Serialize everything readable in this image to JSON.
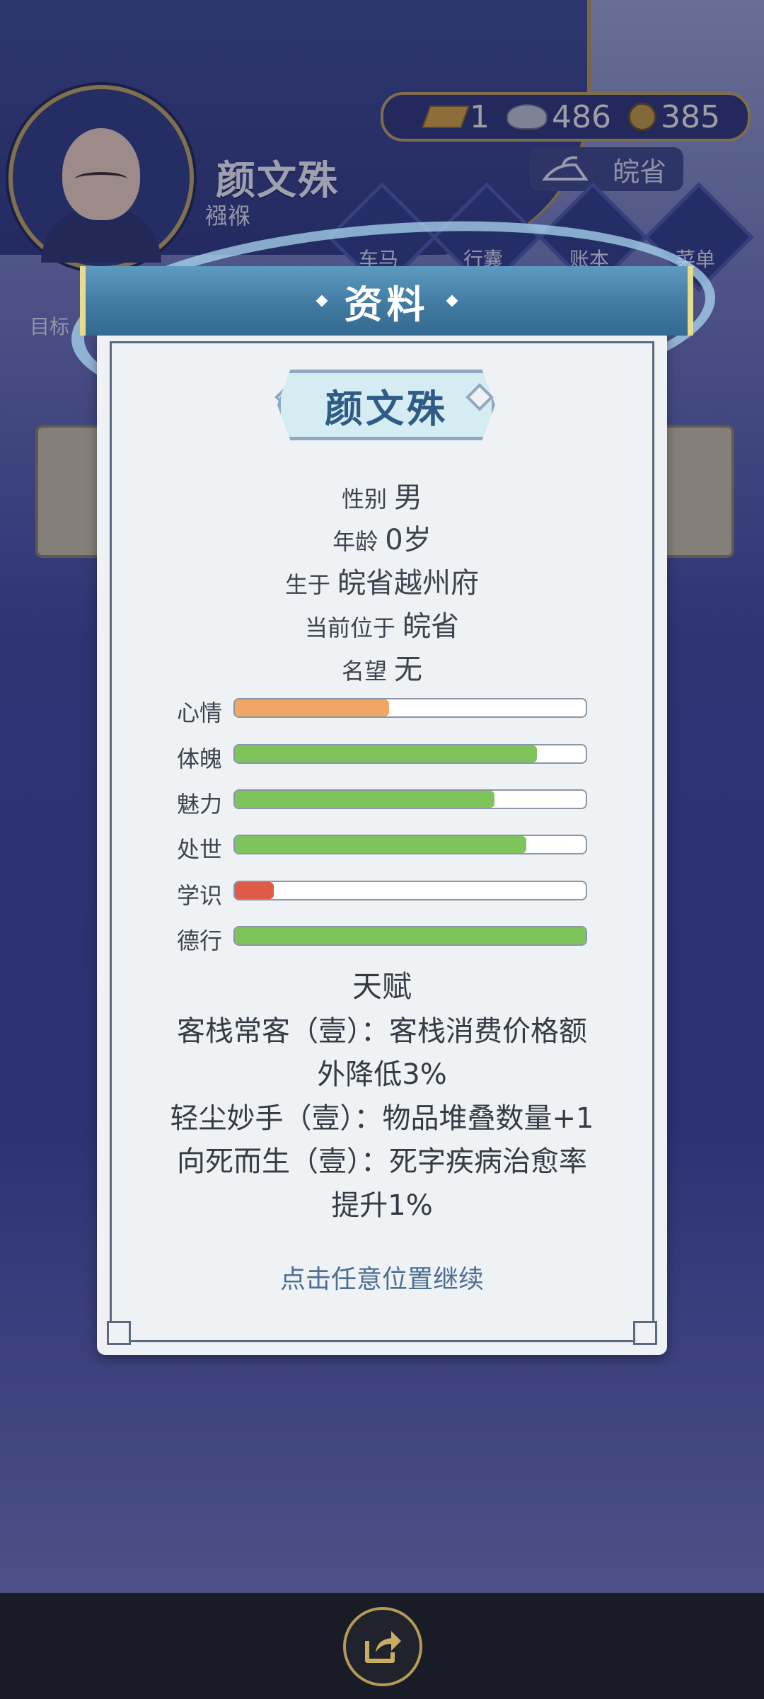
{
  "hud": {
    "player_name": "颜文殊",
    "player_title": "襁褓",
    "currency": {
      "gold": "1",
      "silver": "486",
      "copper": "385"
    },
    "region": "皖省",
    "menu": [
      "车马",
      "行囊",
      "账本",
      "菜单"
    ],
    "goal_label": "目标"
  },
  "dialog": {
    "title": "资料",
    "name": "颜文殊",
    "info": [
      {
        "label": "性别",
        "value": "男"
      },
      {
        "label": "年龄",
        "value": "0岁"
      },
      {
        "label": "生于",
        "value": "皖省越州府"
      },
      {
        "label": "当前位于",
        "value": "皖省"
      },
      {
        "label": "名望",
        "value": "无"
      }
    ],
    "stats": [
      {
        "label": "心情",
        "percent": 44,
        "color": "#f0a765"
      },
      {
        "label": "体魄",
        "percent": 86,
        "color": "#7fc45a"
      },
      {
        "label": "魅力",
        "percent": 74,
        "color": "#7fc45a"
      },
      {
        "label": "处世",
        "percent": 83,
        "color": "#7fc45a"
      },
      {
        "label": "学识",
        "percent": 11,
        "color": "#e05a48"
      },
      {
        "label": "德行",
        "percent": 100,
        "color": "#7fc45a"
      }
    ],
    "talent_title": "天赋",
    "talent_lines": [
      "客栈常客（壹）：客栈消费价格额",
      "外降低3%",
      "轻尘妙手（壹）：物品堆叠数量+1",
      "向死而生（壹）：死字疾病治愈率",
      "提升1%"
    ],
    "continue_hint": "点击任意位置继续"
  },
  "icons": {
    "share": "share-icon",
    "gold": "gold-ingot-icon",
    "silver": "silver-ingot-icon",
    "copper": "copper-coin-icon",
    "region": "iron-icon"
  }
}
